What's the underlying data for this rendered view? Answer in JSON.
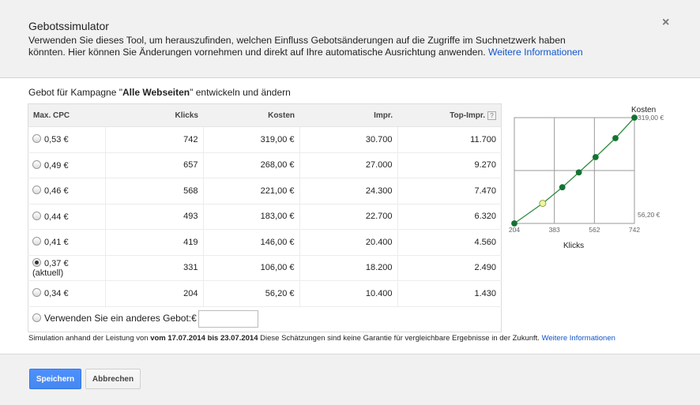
{
  "dialog": {
    "title": "Gebotssimulator",
    "close_glyph": "×",
    "description": "Verwenden Sie dieses Tool, um herauszufinden, welchen Einfluss Gebotsänderungen auf die Zugriffe im Suchnetzwerk haben könnten. Hier können Sie Änderungen vornehmen und direkt auf Ihre automatische Ausrichtung anwenden.",
    "more_info_link": "Weitere Informationen"
  },
  "subheading": {
    "prefix": "Gebot für Kampagne \"",
    "campaign": "Alle Webseiten",
    "suffix": "\" entwickeln und ändern"
  },
  "table": {
    "headers": [
      "Max. CPC",
      "Klicks",
      "Kosten",
      "Impr.",
      "Top-Impr."
    ],
    "help_glyph": "?",
    "rows": [
      {
        "cpc": "0,53 €",
        "klicks": "742",
        "kosten": "319,00 €",
        "impr": "30.700",
        "top": "11.700",
        "selected": false
      },
      {
        "cpc": "0,49 €",
        "klicks": "657",
        "kosten": "268,00 €",
        "impr": "27.000",
        "top": "9.270",
        "selected": false
      },
      {
        "cpc": "0,46 €",
        "klicks": "568",
        "kosten": "221,00 €",
        "impr": "24.300",
        "top": "7.470",
        "selected": false
      },
      {
        "cpc": "0,44 €",
        "klicks": "493",
        "kosten": "183,00 €",
        "impr": "22.700",
        "top": "6.320",
        "selected": false
      },
      {
        "cpc": "0,41 €",
        "klicks": "419",
        "kosten": "146,00 €",
        "impr": "20.400",
        "top": "4.560",
        "selected": false
      },
      {
        "cpc": "0,37 € (aktuell)",
        "klicks": "331",
        "kosten": "106,00 €",
        "impr": "18.200",
        "top": "2.490",
        "selected": true
      },
      {
        "cpc": "0,34 €",
        "klicks": "204",
        "kosten": "56,20 €",
        "impr": "10.400",
        "top": "1.430",
        "selected": false
      }
    ],
    "other_bid_label": "Verwenden Sie ein anderes Gebot:",
    "other_bid_currency": "€",
    "other_bid_value": ""
  },
  "chart_data": {
    "type": "line",
    "ylabel": "Kosten",
    "xlabel": "Klicks",
    "x_ticks": [
      "204",
      "383",
      "562",
      "742"
    ],
    "y_ticks": [
      "56,20 €",
      "319,00 €"
    ],
    "xlim": [
      204,
      742
    ],
    "ylim": [
      56.2,
      319
    ],
    "x": [
      204,
      331,
      419,
      493,
      568,
      657,
      742
    ],
    "y": [
      56.2,
      106,
      146,
      183,
      221,
      268,
      319
    ],
    "highlight_index": 1,
    "line_color": "#2e8b3f",
    "point_color": "#137333",
    "highlight_color": "#f2f2a6",
    "grid": true
  },
  "footnote": {
    "prefix": "Simulation anhand der Leistung von ",
    "range": "vom 17.07.2014 bis 23.07.2014",
    "suffix": " Diese Schätzungen sind keine Garantie für vergleichbare Ergebnisse in der Zukunft. ",
    "link": "Weitere Informationen"
  },
  "footer": {
    "save_label": "Speichern",
    "cancel_label": "Abbrechen"
  }
}
